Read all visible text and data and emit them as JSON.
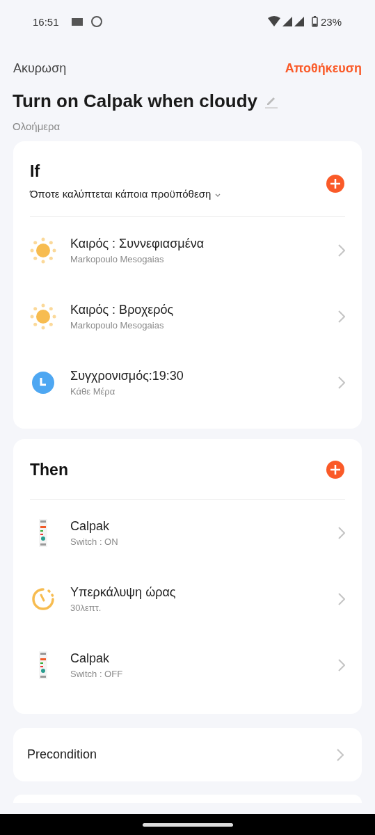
{
  "status_bar": {
    "time": "16:51",
    "battery": "23%"
  },
  "top_bar": {
    "cancel": "Ακυρωση",
    "save": "Αποθήκευση"
  },
  "scene": {
    "title": "Turn on Calpak when cloudy",
    "schedule": "Ολοήμερα"
  },
  "if_card": {
    "heading": "If",
    "condition_mode": "Όποτε καλύπτεται κάποια προϋπόθεση",
    "items": [
      {
        "kind": "weather",
        "title": "Καιρός : Συννεφιασμένα",
        "subtitle": "Markopoulo Mesogaias"
      },
      {
        "kind": "weather",
        "title": "Καιρός : Βροχερός",
        "subtitle": "Markopoulo Mesogaias"
      },
      {
        "kind": "schedule",
        "title": "Συγχρονισμός:19:30",
        "subtitle": "Κάθε Μέρα"
      }
    ]
  },
  "then_card": {
    "heading": "Then",
    "items": [
      {
        "kind": "device",
        "title": "Calpak",
        "subtitle": "Switch : ON"
      },
      {
        "kind": "delay",
        "title": "Υπερκάλυψη ώρας",
        "subtitle": "30λεπτ."
      },
      {
        "kind": "device",
        "title": "Calpak",
        "subtitle": "Switch : OFF"
      }
    ]
  },
  "precondition": {
    "label": "Precondition"
  }
}
